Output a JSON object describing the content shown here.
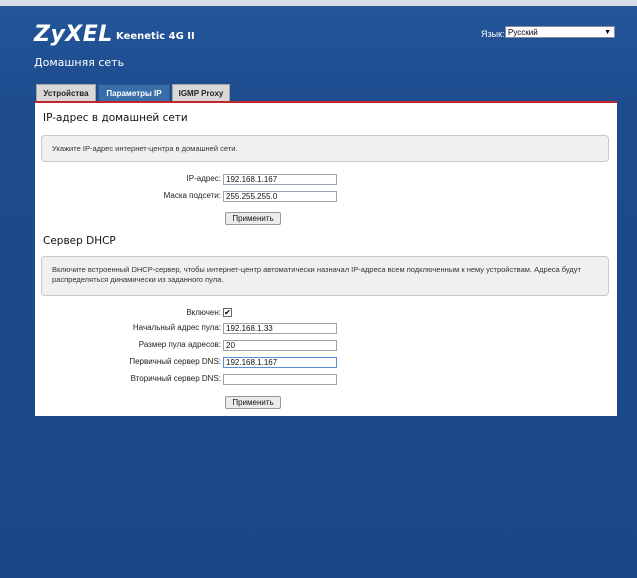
{
  "header": {
    "logo": "ZyXEL",
    "model": "Keenetic 4G II",
    "language_label": "Язык:",
    "language_value": "Русский",
    "page_title": "Домашняя сеть"
  },
  "tabs": [
    {
      "label": "Устройства",
      "active": false
    },
    {
      "label": "Параметры IP",
      "active": true
    },
    {
      "label": "IGMP Proxy",
      "active": false
    }
  ],
  "ip_section": {
    "title": "IP-адрес в домашней сети",
    "info": "Укажите IP-адрес интернет-центра в домашней сети.",
    "ip_label": "IP-адрес:",
    "ip_value": "192.168.1.167",
    "mask_label": "Маска подсети:",
    "mask_value": "255.255.255.0",
    "apply": "Применить"
  },
  "dhcp_section": {
    "title": "Сервер DHCP",
    "info": "Включите встроенный DHCP-сервер, чтобы интернет-центр автоматически назначал IP-адреса всем подключенным к нему устройствам. Адреса будут распределяться динамически из заданного пула.",
    "enabled_label": "Включен:",
    "enabled": true,
    "start_label": "Начальный адрес пула:",
    "start_value": "192.168.1.33",
    "size_label": "Размер пула адресов:",
    "size_value": "20",
    "dns1_label": "Первичный сервер DNS:",
    "dns1_value": "192.168.1.167",
    "dns2_label": "Вторичный сервер DNS:",
    "dns2_value": "",
    "apply": "Применить"
  }
}
